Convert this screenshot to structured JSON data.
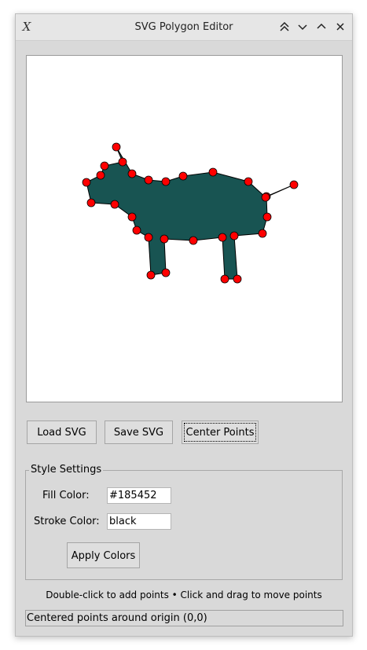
{
  "window": {
    "title": "SVG Polygon Editor",
    "controls": [
      "keep-above-icon",
      "minimize-icon",
      "maximize-icon",
      "close-icon"
    ]
  },
  "canvas": {
    "fill_color": "#185452",
    "stroke_color": "black",
    "point_color": "#ff0000"
  },
  "buttons": {
    "load": "Load SVG",
    "save": "Save SVG",
    "center": "Center Points"
  },
  "style_settings": {
    "title": "Style Settings",
    "fill_label": "Fill Color:",
    "fill_value": "#185452",
    "stroke_label": "Stroke Color:",
    "stroke_value": "black",
    "apply": "Apply Colors"
  },
  "hint": "Double-click to add points • Click and drag to move points",
  "status": "Centered points around origin (0,0)"
}
